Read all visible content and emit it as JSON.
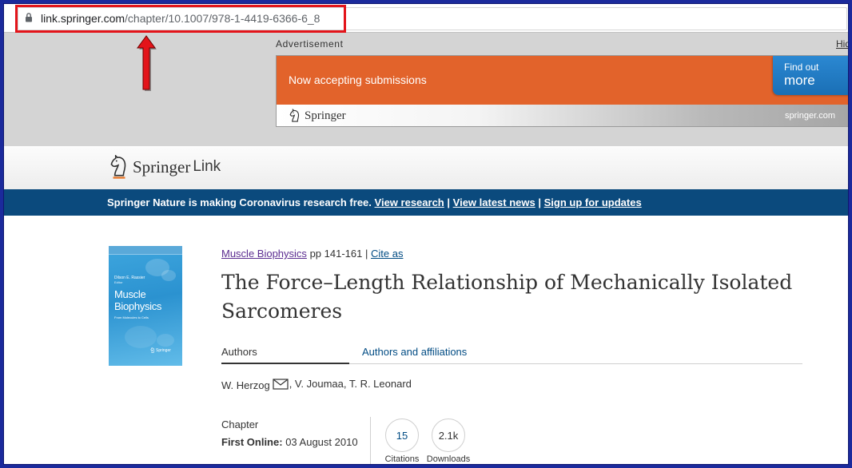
{
  "browser": {
    "url_host": "link.springer.com",
    "url_path": "/chapter/10.1007/978-1-4419-6366-6_8",
    "lock_icon": "lock-icon"
  },
  "annotation": {
    "highlight_color": "#e3141a",
    "arrow_icon": "up-arrow-icon"
  },
  "ad": {
    "label": "Advertisement",
    "hide_label": "Hid",
    "headline": "Now accepting submissions",
    "cta_line1": "Find out",
    "cta_line2": "more",
    "brand": "Springer",
    "domain": "springer.com",
    "banner_color": "#e2632b",
    "cta_color": "#1f78c1"
  },
  "header": {
    "logo_word1": "Springer",
    "logo_word2": "Link",
    "logo_icon": "springer-horse-icon"
  },
  "banner": {
    "message": "Springer Nature is making Coronavirus research free.",
    "links": [
      "View research",
      "View latest news",
      "Sign up for updates"
    ],
    "separator": "|",
    "color": "#0b4a7d"
  },
  "chapter": {
    "book_title": "Muscle Biophysics",
    "pages": "pp 141-161",
    "separator": "|",
    "cite_label": "Cite as",
    "title": "The Force–Length Relationship of Mechanically Isolated Sarcomeres",
    "cover": {
      "editor": "Dilson E. Rassier",
      "role": "Editor",
      "title_line1": "Muscle",
      "title_line2": "Biophysics",
      "subtitle": "From Molecules to Cells",
      "publisher": "Springer"
    },
    "tabs": [
      {
        "label": "Authors",
        "active": true
      },
      {
        "label": "Authors and affiliations",
        "active": false
      }
    ],
    "authors": {
      "first": "W. Herzog",
      "rest": ", V. Joumaa, T. R. Leonard",
      "email_icon": "envelope-icon"
    },
    "type": "Chapter",
    "first_online_label": "First Online:",
    "first_online_date": "03 August 2010",
    "metrics": [
      {
        "value": "15",
        "label": "Citations"
      },
      {
        "value": "2.1k",
        "label": "Downloads"
      }
    ]
  }
}
